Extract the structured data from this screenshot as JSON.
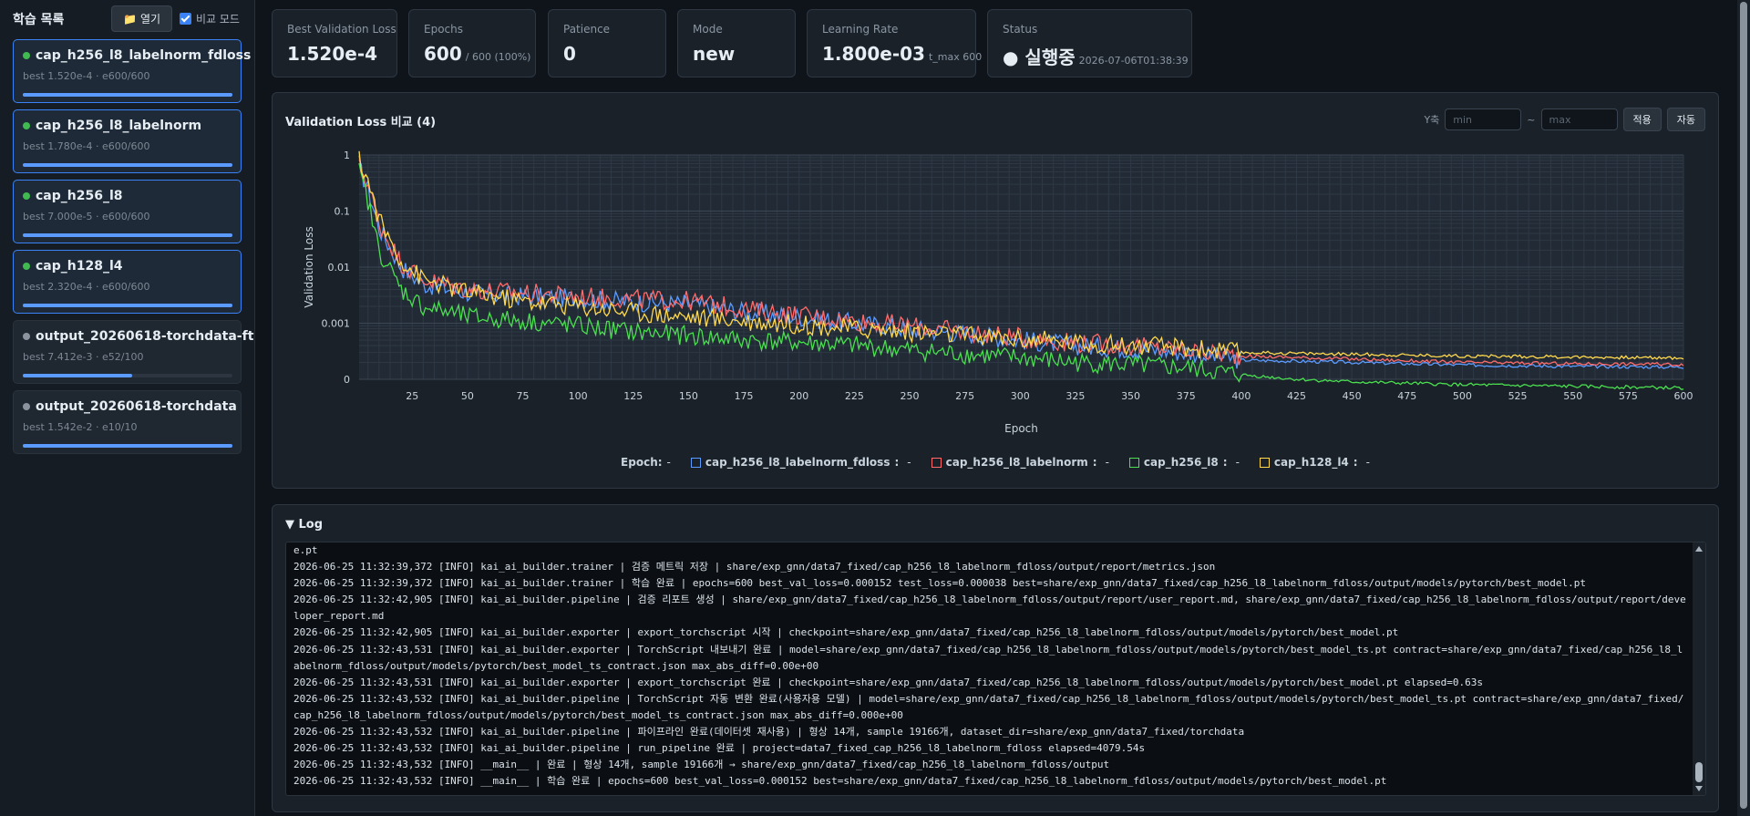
{
  "sidebar": {
    "title": "학습 목록",
    "open_button": "열기",
    "open_icon": "folder-icon",
    "compare_mode": "비교 모드",
    "compare_checked": true,
    "runs": [
      {
        "name": "cap_h256_l8_labelnorm_fdloss",
        "meta": "best 1.520e-4 · e600/600",
        "progress": 1.0,
        "status": "running",
        "status_color": "#3fb950",
        "selected": true
      },
      {
        "name": "cap_h256_l8_labelnorm",
        "meta": "best 1.780e-4 · e600/600",
        "progress": 1.0,
        "status": "running",
        "status_color": "#3fb950",
        "selected": true
      },
      {
        "name": "cap_h256_l8",
        "meta": "best 7.000e-5 · e600/600",
        "progress": 1.0,
        "status": "running",
        "status_color": "#3fb950",
        "selected": true
      },
      {
        "name": "cap_h128_l4",
        "meta": "best 2.320e-4 · e600/600",
        "progress": 1.0,
        "status": "running",
        "status_color": "#3fb950",
        "selected": true
      },
      {
        "name": "output_20260618-torchdata-ft",
        "meta": "best 7.412e-3 · e52/100",
        "progress": 0.52,
        "status": "stopped",
        "status_color": "#8b949e",
        "selected": false
      },
      {
        "name": "output_20260618-torchdata",
        "meta": "best 1.542e-2 · e10/10",
        "progress": 1.0,
        "status": "stopped",
        "status_color": "#8b949e",
        "selected": false
      }
    ]
  },
  "stats": {
    "best_val_loss": {
      "label": "Best Validation Loss",
      "value": "1.520e-4"
    },
    "epochs": {
      "label": "Epochs",
      "value": "600",
      "sub": "/ 600 (100%)"
    },
    "patience": {
      "label": "Patience",
      "value": "0"
    },
    "mode": {
      "label": "Mode",
      "value": "new"
    },
    "learning_rate": {
      "label": "Learning Rate",
      "value": "1.800e-03",
      "sub": "t_max 600"
    },
    "status": {
      "label": "Status",
      "value": "● 실행중",
      "sub": "2026-07-06T01:38:39"
    }
  },
  "chart": {
    "title": "Validation Loss 비교 (4)",
    "yaxis_label": "Y축",
    "min_placeholder": "min",
    "max_placeholder": "max",
    "range_separator": "~",
    "apply_button": "적용",
    "auto_button": "자동",
    "legend_epoch": "Epoch:",
    "legend_dash": "-"
  },
  "chart_data": {
    "type": "line",
    "xlabel": "Epoch",
    "ylabel": "Validation Loss",
    "xlim": [
      1,
      600
    ],
    "ylim_log10": [
      -4,
      0
    ],
    "y_scale": "log",
    "grid": true,
    "legend_position": "bottom",
    "x_ticks": [
      25,
      50,
      75,
      100,
      125,
      150,
      175,
      200,
      225,
      250,
      275,
      300,
      325,
      350,
      375,
      400,
      425,
      450,
      475,
      500,
      525,
      550,
      575,
      600
    ],
    "y_ticks": [
      {
        "value": 1,
        "label": "1"
      },
      {
        "value": 0.1,
        "label": "0.1"
      },
      {
        "value": 0.01,
        "label": "0.01"
      },
      {
        "value": 0.001,
        "label": "0.001"
      },
      {
        "value": 0.0001,
        "label": "0"
      }
    ],
    "series": [
      {
        "name": "cap_h256_l8_labelnorm_fdloss",
        "color": "#5b9bff",
        "x": [
          1,
          5,
          10,
          20,
          30,
          50,
          75,
          100,
          125,
          150,
          175,
          200,
          225,
          250,
          275,
          300,
          325,
          350,
          375,
          400,
          450,
          500,
          550,
          600
        ],
        "y": [
          0.6,
          0.25,
          0.05,
          0.01,
          0.005,
          0.0035,
          0.003,
          0.0028,
          0.0024,
          0.0022,
          0.0016,
          0.0013,
          0.001,
          0.0008,
          0.00065,
          0.0005,
          0.0004,
          0.00035,
          0.0003,
          0.00022,
          0.0002,
          0.00018,
          0.00017,
          0.000165
        ]
      },
      {
        "name": "cap_h256_l8_labelnorm",
        "color": "#ff6b6b",
        "x": [
          1,
          5,
          10,
          20,
          30,
          50,
          75,
          100,
          125,
          150,
          175,
          200,
          225,
          250,
          275,
          300,
          325,
          350,
          375,
          400,
          450,
          500,
          550,
          600
        ],
        "y": [
          0.7,
          0.3,
          0.06,
          0.012,
          0.006,
          0.004,
          0.0035,
          0.003,
          0.0027,
          0.0025,
          0.0018,
          0.0014,
          0.0011,
          0.0009,
          0.0007,
          0.00055,
          0.00045,
          0.0004,
          0.00033,
          0.00026,
          0.00023,
          0.0002,
          0.00019,
          0.000185
        ]
      },
      {
        "name": "cap_h256_l8",
        "color": "#4ade50",
        "x": [
          1,
          5,
          10,
          20,
          30,
          50,
          75,
          100,
          125,
          150,
          175,
          200,
          225,
          250,
          275,
          300,
          325,
          350,
          375,
          400,
          425,
          450,
          475,
          500,
          550,
          600
        ],
        "y": [
          0.5,
          0.15,
          0.02,
          0.004,
          0.002,
          0.0013,
          0.0011,
          0.0009,
          0.0007,
          0.0006,
          0.0005,
          0.00045,
          0.0004,
          0.00033,
          0.00028,
          0.00024,
          0.0002,
          0.00018,
          0.00016,
          0.00012,
          0.0001,
          9e-05,
          8.5e-05,
          8e-05,
          7.5e-05,
          7e-05
        ]
      },
      {
        "name": "cap_h128_l4",
        "color": "#ffd84d",
        "x": [
          1,
          5,
          10,
          20,
          30,
          50,
          75,
          100,
          125,
          150,
          175,
          200,
          225,
          250,
          275,
          300,
          325,
          350,
          375,
          400,
          450,
          500,
          550,
          600
        ],
        "y": [
          0.8,
          0.35,
          0.07,
          0.013,
          0.006,
          0.0035,
          0.0025,
          0.002,
          0.0016,
          0.0013,
          0.0011,
          0.00095,
          0.0008,
          0.0007,
          0.0006,
          0.00052,
          0.00045,
          0.0004,
          0.00036,
          0.0003,
          0.00028,
          0.00026,
          0.00025,
          0.00024
        ]
      }
    ]
  },
  "log": {
    "title": "▼ Log",
    "lines": [
      "e.pt",
      "2026-06-25 11:32:39,372 [INFO] kai_ai_builder.trainer | 검증 메트릭 저장 | share/exp_gnn/data7_fixed/cap_h256_l8_labelnorm_fdloss/output/report/metrics.json",
      "2026-06-25 11:32:39,372 [INFO] kai_ai_builder.trainer | 학습 완료 | epochs=600 best_val_loss=0.000152 test_loss=0.000038 best=share/exp_gnn/data7_fixed/cap_h256_l8_labelnorm_fdloss/output/models/pytorch/best_model.pt",
      "2026-06-25 11:32:42,905 [INFO] kai_ai_builder.pipeline | 검증 리포트 생성 | share/exp_gnn/data7_fixed/cap_h256_l8_labelnorm_fdloss/output/report/user_report.md, share/exp_gnn/data7_fixed/cap_h256_l8_labelnorm_fdloss/output/report/developer_report.md",
      "2026-06-25 11:32:42,905 [INFO] kai_ai_builder.exporter | export_torchscript 시작 | checkpoint=share/exp_gnn/data7_fixed/cap_h256_l8_labelnorm_fdloss/output/models/pytorch/best_model.pt",
      "2026-06-25 11:32:43,531 [INFO] kai_ai_builder.exporter | TorchScript 내보내기 완료 | model=share/exp_gnn/data7_fixed/cap_h256_l8_labelnorm_fdloss/output/models/pytorch/best_model_ts.pt contract=share/exp_gnn/data7_fixed/cap_h256_l8_labelnorm_fdloss/output/models/pytorch/best_model_ts_contract.json max_abs_diff=0.00e+00",
      "2026-06-25 11:32:43,531 [INFO] kai_ai_builder.exporter | export_torchscript 완료 | checkpoint=share/exp_gnn/data7_fixed/cap_h256_l8_labelnorm_fdloss/output/models/pytorch/best_model.pt elapsed=0.63s",
      "2026-06-25 11:32:43,532 [INFO] kai_ai_builder.pipeline | TorchScript 자동 변환 완료(사용자용 모델) | model=share/exp_gnn/data7_fixed/cap_h256_l8_labelnorm_fdloss/output/models/pytorch/best_model_ts.pt contract=share/exp_gnn/data7_fixed/cap_h256_l8_labelnorm_fdloss/output/models/pytorch/best_model_ts_contract.json max_abs_diff=0.000e+00",
      "2026-06-25 11:32:43,532 [INFO] kai_ai_builder.pipeline | 파이프라인 완료(데이터셋 재사용) | 형상 14개, sample 19166개, dataset_dir=share/exp_gnn/data7_fixed/torchdata",
      "2026-06-25 11:32:43,532 [INFO] kai_ai_builder.pipeline | run_pipeline 완료 | project=data7_fixed_cap_h256_l8_labelnorm_fdloss elapsed=4079.54s",
      "2026-06-25 11:32:43,532 [INFO] __main__ | 완료 | 형상 14개, sample 19166개 → share/exp_gnn/data7_fixed/cap_h256_l8_labelnorm_fdloss/output",
      "2026-06-25 11:32:43,532 [INFO] __main__ | 학습 완료 | epochs=600 best_val_loss=0.000152 best=share/exp_gnn/data7_fixed/cap_h256_l8_labelnorm_fdloss/output/models/pytorch/best_model.pt"
    ]
  }
}
